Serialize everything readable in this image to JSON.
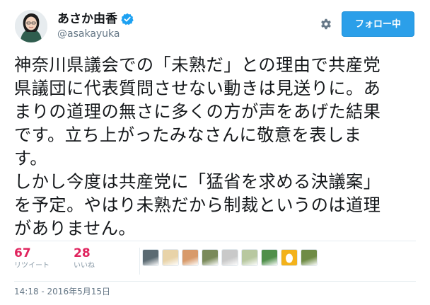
{
  "user": {
    "name": "あさか由香",
    "handle": "@asakayuka"
  },
  "actions": {
    "follow_label": "フォロー中"
  },
  "tweet": {
    "text": "神奈川県議会での「未熟だ」との理由で共産党\n県議団に代表質問させない動きは見送りに。あ\nまりの道理の無さに多くの方が声をあげた結果\nです。立ち上がったみなさんに敬意を表しま\nす。\nしかし今度は共産党に「猛省を求める決議案」\nを予定。やはり未熟だから制裁というのは道理\nがありません。",
    "timestamp": "14:18 - 2016年5月15日"
  },
  "stats": {
    "retweets": {
      "count": "67",
      "label": "リツイート"
    },
    "likes": {
      "count": "28",
      "label": "いいね"
    }
  },
  "likers": [
    {
      "name": "liker-1",
      "color": "#5b6a72"
    },
    {
      "name": "liker-2",
      "color": "#e8d3a8"
    },
    {
      "name": "liker-3",
      "color": "#d89a6a"
    },
    {
      "name": "liker-4",
      "color": "#7a8a5a"
    },
    {
      "name": "liker-5",
      "color": "#c9c9c9"
    },
    {
      "name": "liker-6",
      "color": "#b8c8a0"
    },
    {
      "name": "liker-7",
      "color": "#4f8f4a"
    },
    {
      "name": "liker-8",
      "color": "#f3b21b"
    },
    {
      "name": "liker-9",
      "color": "#6f8c45"
    }
  ],
  "colors": {
    "accent": "#2b9fe9",
    "stat_number": "#e0245e",
    "verified": "#1da1f2"
  }
}
